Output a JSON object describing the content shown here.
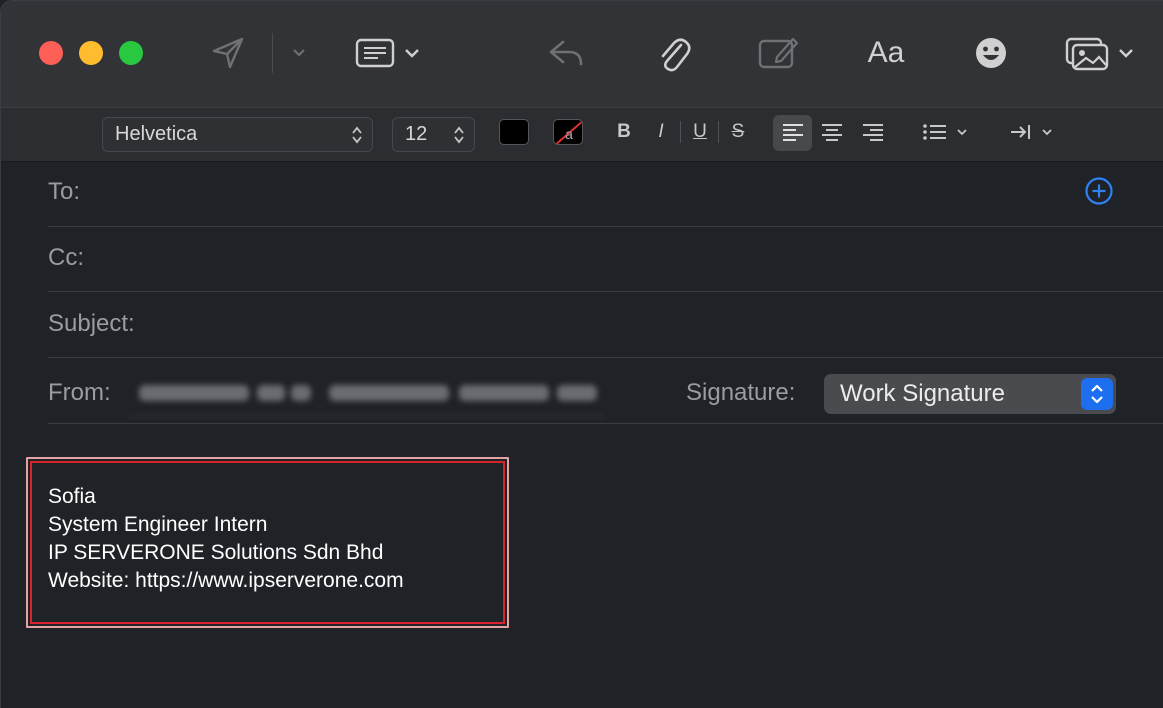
{
  "format_bar": {
    "font_family": "Helvetica",
    "font_size": "12",
    "bold_label": "B",
    "italic_label": "I",
    "underline_label": "U",
    "strike_label": "S"
  },
  "toolbar": {
    "font_label": "Aa"
  },
  "header": {
    "to_label": "To:",
    "cc_label": "Cc:",
    "subject_label": "Subject:",
    "from_label": "From:",
    "signature_label": "Signature:",
    "signature_value": "Work Signature"
  },
  "signature": {
    "lines": [
      "Sofia",
      "System Engineer Intern",
      "IP SERVERONE Solutions Sdn Bhd",
      "Website: https://www.ipserverone.com"
    ]
  },
  "colors": {
    "accent": "#1e6ff0",
    "highlight_outline": "#d8232b"
  }
}
